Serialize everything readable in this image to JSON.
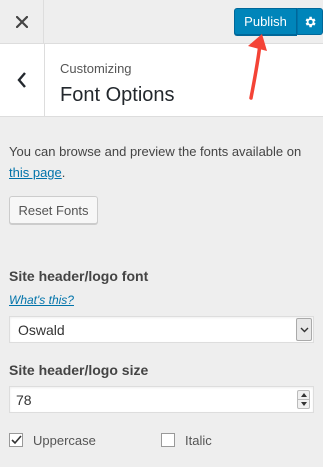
{
  "header": {
    "publish_label": "Publish"
  },
  "section": {
    "customizing_label": "Customizing",
    "title": "Font Options"
  },
  "description": {
    "text": "You can browse and preview the fonts available on",
    "link": "this page",
    "suffix": "."
  },
  "reset_label": "Reset Fonts",
  "font_field": {
    "label": "Site header/logo font",
    "help_link": "What's this?",
    "selected": "Oswald"
  },
  "size_field": {
    "label": "Site header/logo size",
    "value": "78"
  },
  "options": {
    "uppercase": {
      "label": "Uppercase",
      "checked": true
    },
    "italic": {
      "label": "Italic",
      "checked": false
    }
  },
  "colors": {
    "accent": "#0085ba",
    "link": "#0073aa",
    "annotation_arrow": "#f44336"
  },
  "icons": {
    "close": "close-icon",
    "settings": "gear-icon",
    "back": "chevron-left-icon",
    "select": "chevron-down-icon"
  }
}
